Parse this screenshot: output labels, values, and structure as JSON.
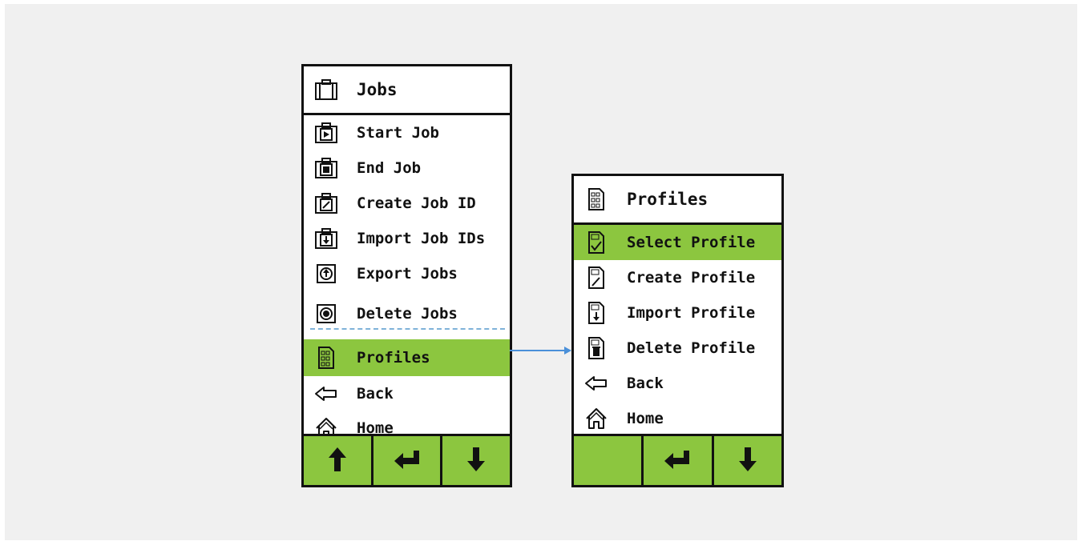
{
  "colors": {
    "accent": "#8cc63f",
    "border": "#111111",
    "connector": "#4a90d9",
    "background": "#f0f0f0"
  },
  "jobs_menu": {
    "title": "Jobs",
    "title_icon": "briefcase-icon",
    "items": [
      {
        "label": "Start Job",
        "icon": "briefcase-play-icon"
      },
      {
        "label": "End Job",
        "icon": "briefcase-stop-icon"
      },
      {
        "label": "Create Job ID",
        "icon": "briefcase-edit-icon"
      },
      {
        "label": "Import Job IDs",
        "icon": "briefcase-import-icon"
      },
      {
        "label": "Export Jobs",
        "icon": "export-circle-icon"
      },
      {
        "label": "Delete Jobs",
        "icon": "delete-circle-icon"
      },
      {
        "label": "Profiles",
        "icon": "profile-document-icon",
        "selected": true
      },
      {
        "label": "Back",
        "icon": "back-arrow-icon"
      },
      {
        "label": "Home",
        "icon": "home-icon"
      }
    ],
    "footer_buttons": [
      "up-arrow-icon",
      "enter-icon",
      "down-arrow-icon"
    ]
  },
  "profiles_menu": {
    "title": "Profiles",
    "title_icon": "profile-document-icon",
    "items": [
      {
        "label": "Select Profile",
        "icon": "profile-check-icon",
        "selected": true
      },
      {
        "label": "Create Profile",
        "icon": "profile-edit-icon"
      },
      {
        "label": "Import Profile",
        "icon": "profile-import-icon"
      },
      {
        "label": "Delete Profile",
        "icon": "profile-delete-icon"
      },
      {
        "label": "Back",
        "icon": "back-arrow-icon"
      },
      {
        "label": "Home",
        "icon": "home-icon"
      }
    ],
    "footer_buttons": [
      "blank",
      "enter-icon",
      "down-arrow-icon"
    ]
  }
}
